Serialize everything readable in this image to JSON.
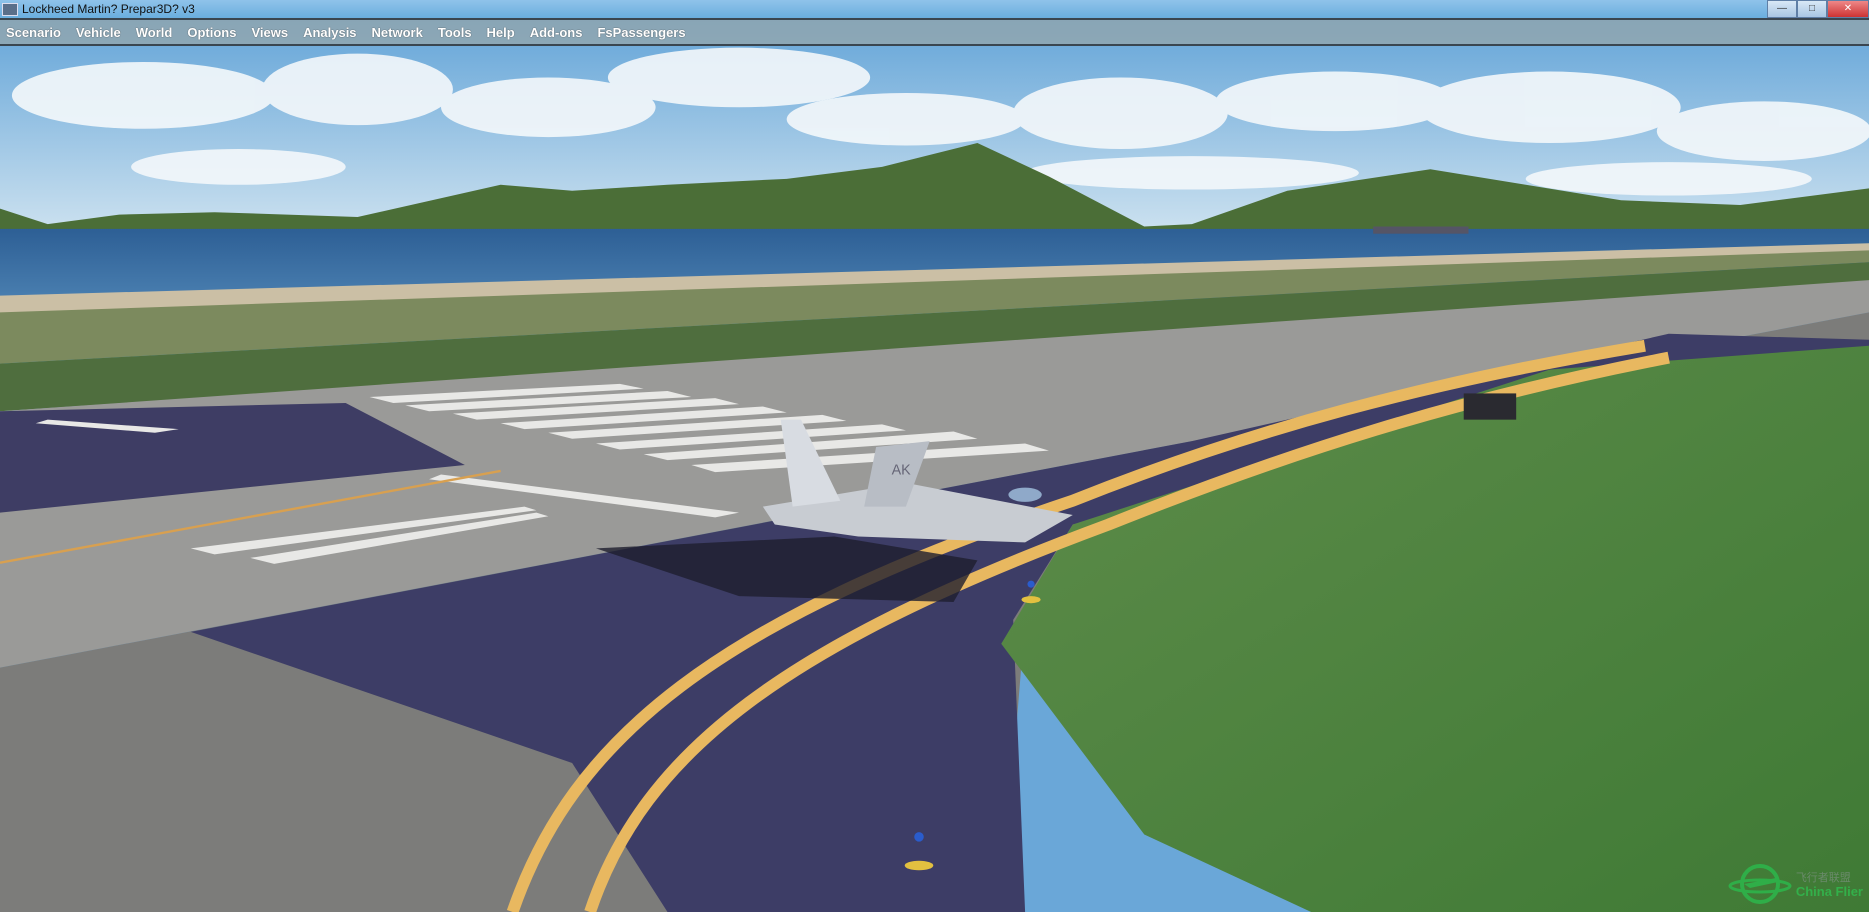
{
  "window": {
    "title": "Lockheed Martin? Prepar3D? v3",
    "controls": [
      "minimize",
      "maximize",
      "close"
    ]
  },
  "menu": {
    "items": [
      "Scenario",
      "Vehicle",
      "World",
      "Options",
      "Views",
      "Analysis",
      "Network",
      "Tools",
      "Help",
      "Add-ons",
      "FsPassengers"
    ]
  },
  "viewport": {
    "aircraft_tail_code": "AK"
  },
  "watermark": {
    "cn": "飞行者联盟",
    "en": "China Flier"
  }
}
